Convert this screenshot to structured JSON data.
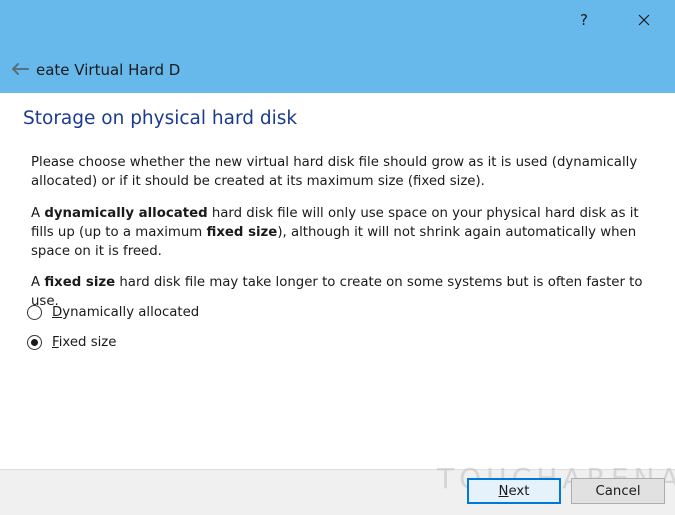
{
  "titlebar": {
    "help_label": "?",
    "close_icon": "close-icon",
    "back_icon": "back-arrow-icon",
    "wizard_title": "eate Virtual Hard D"
  },
  "page": {
    "heading": "Storage on physical hard disk",
    "para1": "Please choose whether the new virtual hard disk file should grow as it is used (dynamically allocated) or if it should be created at its maximum size (fixed size).",
    "para2": {
      "t1": "A ",
      "b1": "dynamically allocated",
      "t2": " hard disk file will only use space on your physical hard disk as it fills up (up to a maximum ",
      "b2": "fixed size",
      "t3": "), although it will not shrink again automatically when space on it is freed."
    },
    "para3": {
      "t1": "A ",
      "b1": "fixed size",
      "t2": " hard disk file may take longer to create on some systems but is often faster to use."
    }
  },
  "options": [
    {
      "mnemonic": "D",
      "rest": "ynamically allocated",
      "checked": false
    },
    {
      "mnemonic": "F",
      "rest": "ixed size",
      "checked": true
    }
  ],
  "footer": {
    "watermark": "TOUCHARENA",
    "next": {
      "mnemonic": "N",
      "rest": "ext"
    },
    "cancel_label": "Cancel"
  },
  "colors": {
    "titlebar": "#67b9ec",
    "heading": "#1b3b8f",
    "default_button_border": "#0078d7"
  }
}
